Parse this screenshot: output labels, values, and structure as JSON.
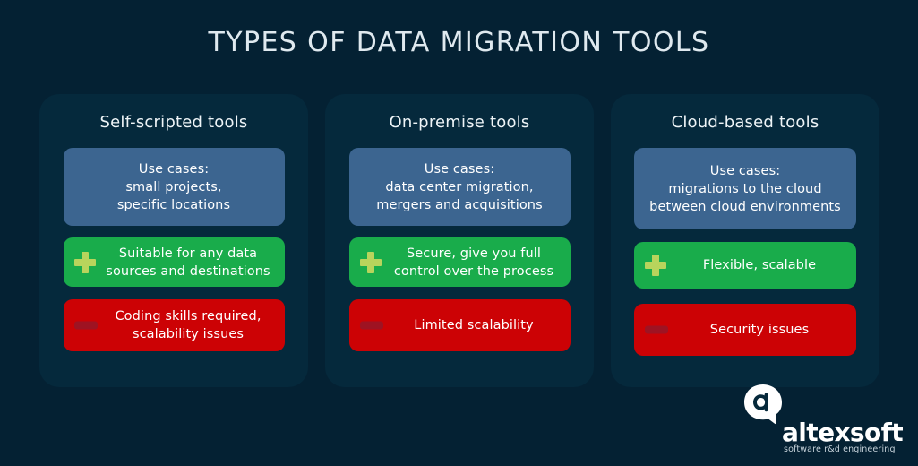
{
  "title": "TYPES OF DATA MIGRATION TOOLS",
  "colors": {
    "page_background": "#042133",
    "panel_background": "#05293c",
    "usecase_blue": "#3c6590",
    "pro_green": "#19ac4b",
    "con_red": "#cc0205",
    "plus_icon": "#b8d45c",
    "minus_icon": "#9e1322",
    "title_text": "#dfe9ef"
  },
  "columns": [
    {
      "title": "Self-scripted tools",
      "usecase": "Use cases:\nsmall projects,\nspecific locations",
      "pro": "Suitable for any data\nsources and destinations",
      "con": "Coding skills required,\nscalability issues",
      "pro_icon": "plus-icon",
      "con_icon": "minus-icon"
    },
    {
      "title": "On-premise tools",
      "usecase": "Use cases:\ndata center migration,\nmergers and acquisitions",
      "pro": "Secure, give you full\ncontrol over the process",
      "con": "Limited scalability",
      "pro_icon": "plus-icon",
      "con_icon": "minus-icon"
    },
    {
      "title": "Cloud-based tools",
      "usecase": "Use cases:\nmigrations to the cloud\nbetween cloud environments",
      "pro": "Flexible, scalable",
      "con": "Security issues",
      "pro_icon": "plus-icon",
      "con_icon": "minus-icon"
    }
  ],
  "logo": {
    "mark": "altexsoft-logo-mark",
    "wordmark": "altexsoft",
    "tagline": "software r&d engineering"
  }
}
